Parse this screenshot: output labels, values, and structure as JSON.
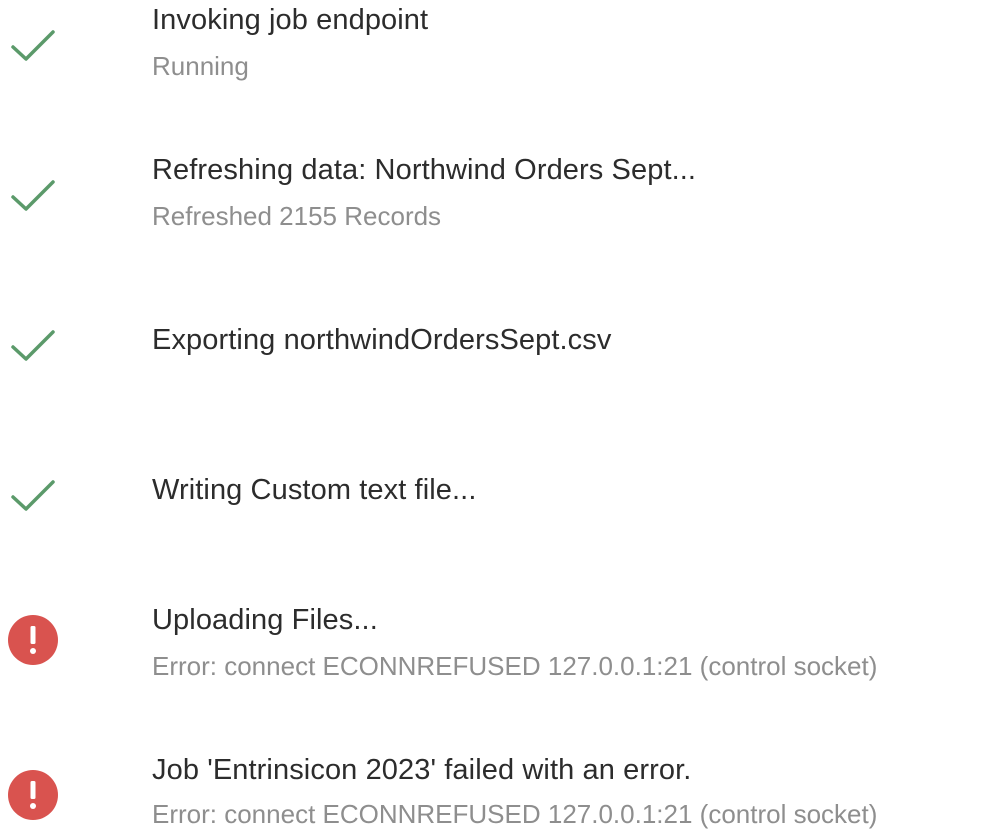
{
  "colors": {
    "success": "#5b9a6a",
    "error": "#d9534f",
    "title_text": "#2c2c2c",
    "subtitle_text": "#8e8e8e"
  },
  "steps": [
    {
      "status": "success",
      "icon": "checkmark-icon",
      "title": "Invoking job endpoint",
      "subtitle": "Running"
    },
    {
      "status": "success",
      "icon": "checkmark-icon",
      "title": "Refreshing data: Northwind Orders Sept...",
      "subtitle": "Refreshed 2155 Records"
    },
    {
      "status": "success",
      "icon": "checkmark-icon",
      "title": "Exporting northwindOrdersSept.csv",
      "subtitle": ""
    },
    {
      "status": "success",
      "icon": "checkmark-icon",
      "title": "Writing Custom text file...",
      "subtitle": ""
    },
    {
      "status": "error",
      "icon": "error-alert-icon",
      "title": "Uploading Files...",
      "subtitle": "Error: connect ECONNREFUSED 127.0.0.1:21 (control socket)"
    },
    {
      "status": "error",
      "icon": "error-alert-icon",
      "title": "Job 'Entrinsicon 2023' failed with an error.",
      "subtitle": "Error: connect ECONNREFUSED 127.0.0.1:21 (control socket)"
    }
  ]
}
